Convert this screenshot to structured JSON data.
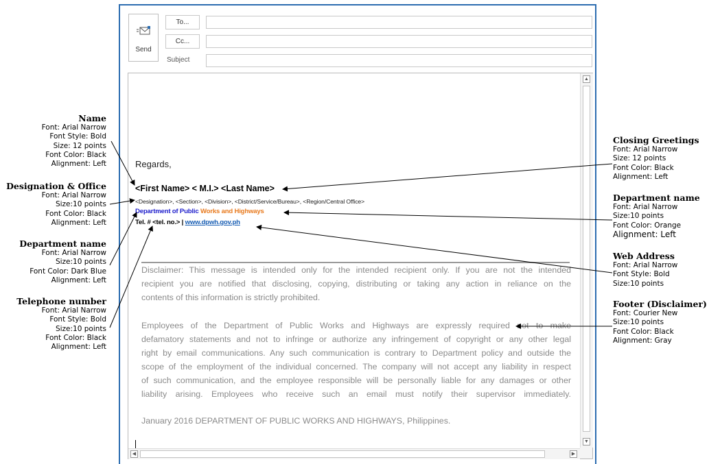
{
  "compose": {
    "send_label": "Send",
    "to_label": "To...",
    "cc_label": "Cc...",
    "subject_label": "Subject",
    "to_value": "",
    "cc_value": "",
    "subject_value": ""
  },
  "email": {
    "greeting": "Regards,",
    "name_line": "<First Name> < M.I.> <Last Name>",
    "designation_line": "<Designation>, <Section>, <Division>, <District/Service/Bureau>, <Region/Central Office>",
    "dept_blue": "Department of Public",
    "dept_orange": "Works and Highways",
    "tel_prefix": "Tel. # <tel. no.> | ",
    "web": "www.dpwh.gov.ph",
    "disclaimer1": [
      "Disclaimer: This message is intended only for the intended recipient only. If you are not the intended",
      "recipient you are notified that disclosing, copying, distributing or taking any action in reliance on the",
      "contents of this information is strictly prohibited."
    ],
    "disclaimer2": [
      "Employees of the Department of Public Works and Highways are expressly required not to make",
      "defamatory statements and not to infringe or authorize any infringement of copyright or any other legal",
      "right by email communications. Any such communication is contrary to Department policy and outside the",
      "scope of the employment of the individual concerned. The company will not accept any liability in respect",
      "of such communication, and the employee responsible will be personally liable for any damages or other",
      "liability arising. Employees who receive such an email must notify their supervisor immediately."
    ],
    "footer_line": "January 2016 DEPARTMENT OF PUBLIC WORKS AND HIGHWAYS, Philippines."
  },
  "annotations": {
    "name": {
      "title": "Name",
      "lines": [
        "Font: Arial Narrow",
        "Font Style: Bold",
        "Size: 12 points",
        "Font Color: Black",
        "Alignment: Left"
      ]
    },
    "designation": {
      "title": "Designation & Office",
      "lines": [
        "Font: Arial Narrow",
        "Size:10 points",
        "Font Color: Black",
        "Alignment: Left"
      ]
    },
    "dept_left": {
      "title": "Department name",
      "lines": [
        "Font: Arial Narrow",
        "Size:10 points",
        "Font Color: Dark Blue",
        "Alignment: Left"
      ]
    },
    "telephone": {
      "title": "Telephone number",
      "lines": [
        "Font: Arial Narrow",
        "Font Style: Bold",
        "Size:10 points",
        "Font Color: Black",
        "Alignment: Left"
      ]
    },
    "closing": {
      "title": "Closing Greetings",
      "lines": [
        "Font: Arial Narrow",
        "Size: 12 points",
        "Font Color: Black",
        "Alignment: Left"
      ]
    },
    "dept_right": {
      "title": "Department name",
      "lines": [
        "Font: Arial Narrow",
        "Size:10 points",
        "Font Color: Orange",
        "Alignment: Left"
      ]
    },
    "web": {
      "title": "Web Address",
      "lines": [
        "Font: Arial Narrow",
        "Font Style: Bold",
        "Size:10 points"
      ]
    },
    "footer": {
      "title": "Footer (Disclaimer)",
      "lines": [
        "Font: Courier New",
        "Size:10 points",
        "Font Color: Black",
        "Alignment: Gray"
      ]
    }
  },
  "colors": {
    "window_border": "#2b6cb0",
    "dept_blue": "#1f1fcc",
    "dept_orange": "#e87a1e",
    "link": "#1a5fb4",
    "disclaimer": "#8a8a8a"
  }
}
